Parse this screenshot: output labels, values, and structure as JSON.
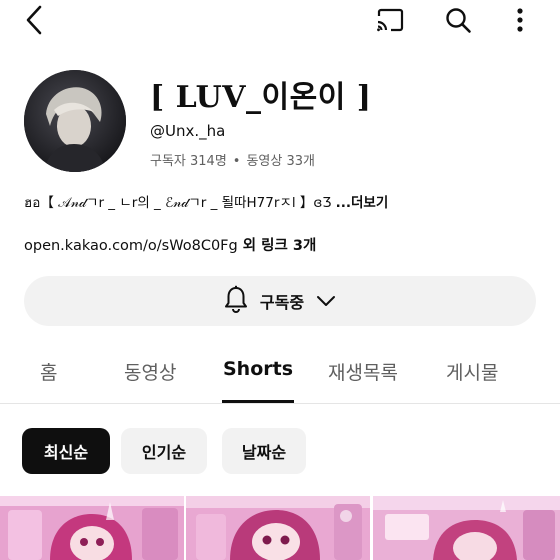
{
  "topbar": {
    "back_icon": "back-arrow-icon",
    "cast_icon": "cast-icon",
    "search_icon": "search-icon",
    "more_icon": "more-vertical-icon"
  },
  "channel": {
    "name": "[ LUV_이온이 ]",
    "handle": "@Unx._ha",
    "subscribers": "구독자 314명",
    "separator": "•",
    "videos": "동영상 33개",
    "description": "ฮอ【 𝒜𝓃𝒹ㄱr _ ㄴr의 _ ℰ𝓃𝒹ㄱr _ 될따H77rㅈl 】ɞƷ ",
    "more_label": "...더보기",
    "link_text": "open.kakao.com/o/sWo8C0Fg",
    "link_extra": " 외 링크 3개"
  },
  "subscribe": {
    "label": "구독중",
    "bell_icon": "bell-icon",
    "chevron_icon": "chevron-down-icon"
  },
  "tabs": [
    {
      "label": "홈",
      "active": false
    },
    {
      "label": "동영상",
      "active": false
    },
    {
      "label": "Shorts",
      "active": true
    },
    {
      "label": "재생목록",
      "active": false
    },
    {
      "label": "게시물",
      "active": false
    }
  ],
  "chips": [
    {
      "label": "최신순",
      "selected": true
    },
    {
      "label": "인기순",
      "selected": false
    },
    {
      "label": "날짜순",
      "selected": false
    }
  ],
  "colors": {
    "text": "#0f0f0f",
    "secondary": "#606060",
    "chip_bg": "#f2f2f2",
    "thumb_pink": "#e98fc6"
  }
}
